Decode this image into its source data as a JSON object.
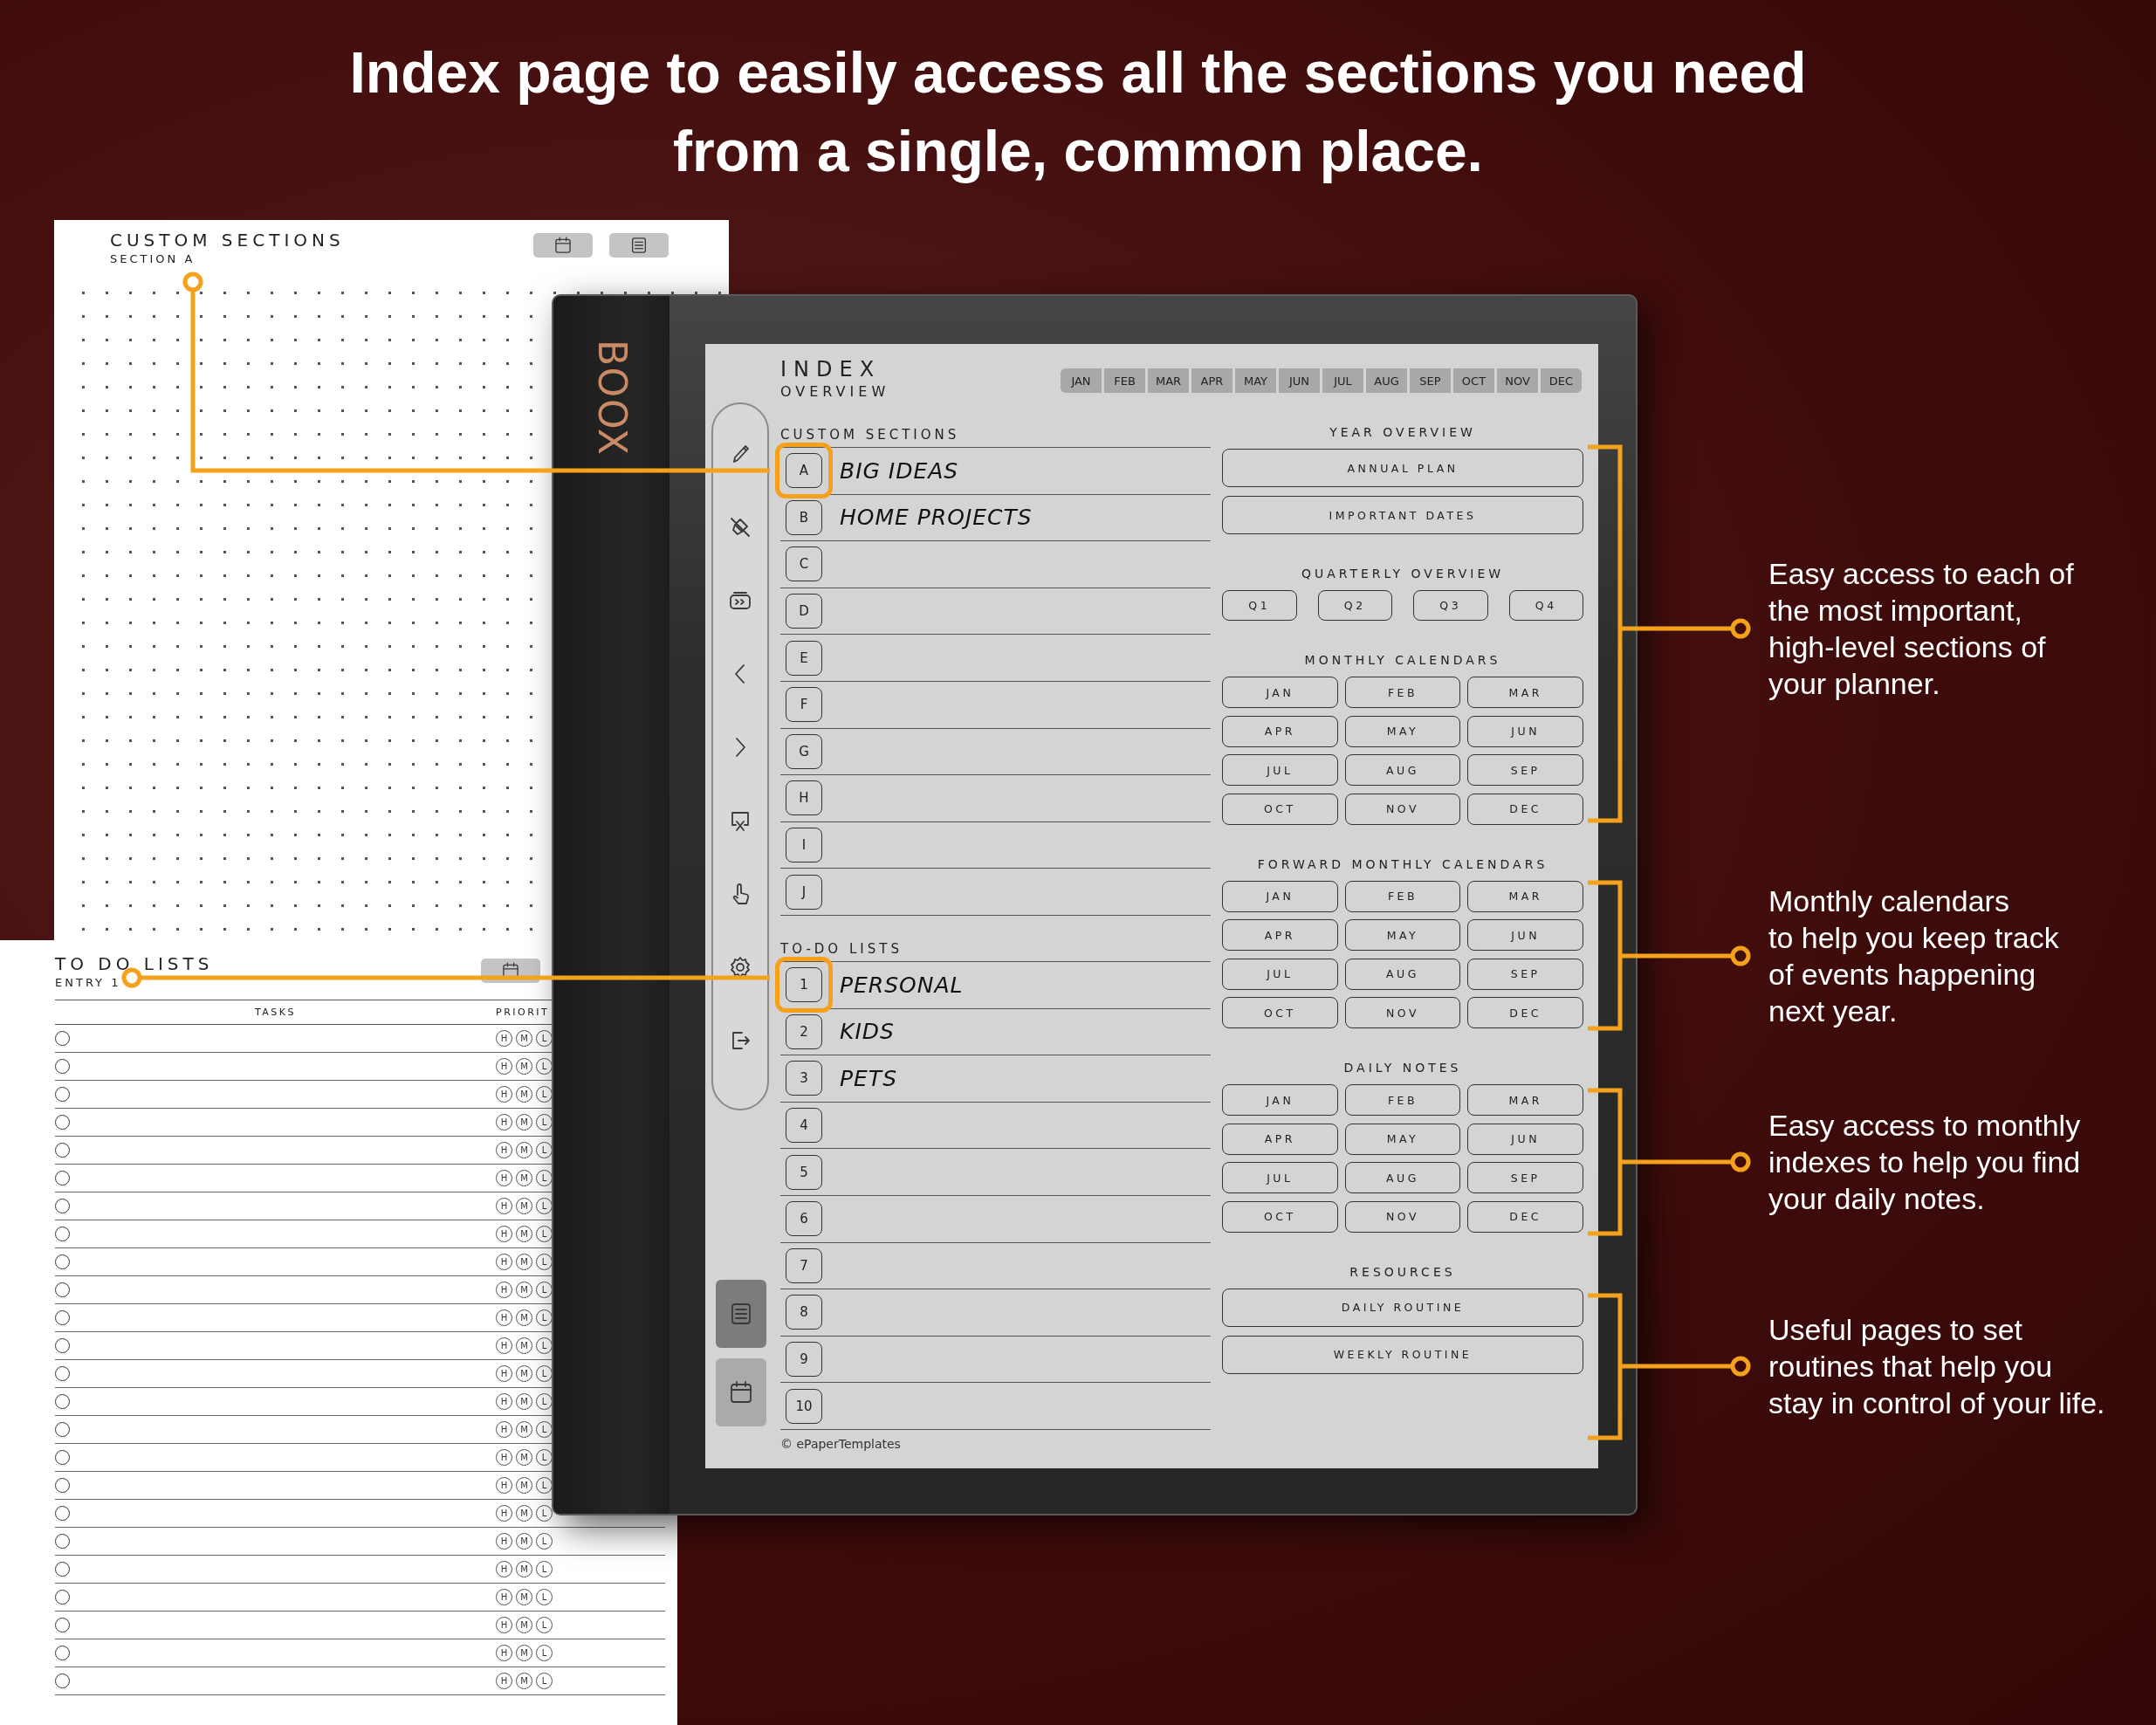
{
  "headline": {
    "lines": [
      "Index page to easily access all the sections you need",
      "from a single, common place."
    ]
  },
  "custom_sections_page": {
    "title": "CUSTOM SECTIONS",
    "subtitle": "SECTION A"
  },
  "todo_page": {
    "title": "TO DO LISTS",
    "subtitle": "ENTRY 1",
    "columns": [
      "TASKS",
      "PRIORIT"
    ],
    "rows": [
      {
        "checked": false,
        "priorities": [
          "H",
          "M",
          "L"
        ]
      },
      {
        "checked": false,
        "priorities": [
          "H",
          "M",
          "L"
        ]
      },
      {
        "checked": false,
        "priorities": [
          "H",
          "M",
          "L"
        ]
      },
      {
        "checked": false,
        "priorities": [
          "H",
          "M",
          "L"
        ]
      },
      {
        "checked": false,
        "priorities": [
          "H",
          "M",
          "L"
        ]
      },
      {
        "checked": false,
        "priorities": [
          "H",
          "M",
          "L"
        ]
      },
      {
        "checked": false,
        "priorities": [
          "H",
          "M",
          "L"
        ]
      },
      {
        "checked": false,
        "priorities": [
          "H",
          "M",
          "L"
        ]
      },
      {
        "checked": false,
        "priorities": [
          "H",
          "M",
          "L"
        ]
      },
      {
        "checked": false,
        "priorities": [
          "H",
          "M",
          "L"
        ]
      },
      {
        "checked": false,
        "priorities": [
          "H",
          "M",
          "L"
        ]
      },
      {
        "checked": false,
        "priorities": [
          "H",
          "M",
          "L"
        ]
      },
      {
        "checked": false,
        "priorities": [
          "H",
          "M",
          "L"
        ]
      },
      {
        "checked": false,
        "priorities": [
          "H",
          "M",
          "L"
        ]
      },
      {
        "checked": false,
        "priorities": [
          "H",
          "M",
          "L"
        ]
      },
      {
        "checked": false,
        "priorities": [
          "H",
          "M",
          "L"
        ]
      },
      {
        "checked": false,
        "priorities": [
          "H",
          "M",
          "L"
        ]
      },
      {
        "checked": false,
        "priorities": [
          "H",
          "M",
          "L"
        ]
      },
      {
        "checked": false,
        "priorities": [
          "H",
          "M",
          "L"
        ]
      },
      {
        "checked": false,
        "priorities": [
          "H",
          "M",
          "L"
        ]
      },
      {
        "checked": false,
        "priorities": [
          "H",
          "M",
          "L"
        ]
      },
      {
        "checked": false,
        "priorities": [
          "H",
          "M",
          "L"
        ]
      },
      {
        "checked": false,
        "priorities": [
          "H",
          "M",
          "L"
        ]
      },
      {
        "checked": false,
        "priorities": [
          "H",
          "M",
          "L"
        ]
      }
    ]
  },
  "device": {
    "brand": "BOOX"
  },
  "index_screen": {
    "title": "INDEX",
    "subtitle": "OVERVIEW",
    "month_tabs": [
      "JAN",
      "FEB",
      "MAR",
      "APR",
      "MAY",
      "JUN",
      "JUL",
      "AUG",
      "SEP",
      "OCT",
      "NOV",
      "DEC"
    ],
    "custom_sections": {
      "title": "CUSTOM SECTIONS",
      "rows": [
        {
          "key": "A",
          "entry": "BIG IDEAS",
          "highlighted": true
        },
        {
          "key": "B",
          "entry": "HOME PROJECTS",
          "highlighted": false
        },
        {
          "key": "C",
          "highlighted": false
        },
        {
          "key": "D",
          "highlighted": false
        },
        {
          "key": "E",
          "highlighted": false
        },
        {
          "key": "F",
          "highlighted": false
        },
        {
          "key": "G",
          "highlighted": false
        },
        {
          "key": "H",
          "highlighted": false
        },
        {
          "key": "I",
          "highlighted": false
        },
        {
          "key": "J",
          "highlighted": false
        }
      ]
    },
    "todo_lists": {
      "title": "TO-DO LISTS",
      "rows": [
        {
          "key": "1",
          "entry": "PERSONAL",
          "highlighted": true
        },
        {
          "key": "2",
          "entry": "KIDS",
          "highlighted": false
        },
        {
          "key": "3",
          "entry": "PETS",
          "highlighted": false
        },
        {
          "key": "4",
          "highlighted": false
        },
        {
          "key": "5",
          "highlighted": false
        },
        {
          "key": "6",
          "highlighted": false
        },
        {
          "key": "7",
          "highlighted": false
        },
        {
          "key": "8",
          "highlighted": false
        },
        {
          "key": "9",
          "highlighted": false
        },
        {
          "key": "10",
          "highlighted": false
        }
      ]
    },
    "copyright": "© ePaperTemplates",
    "sections": [
      {
        "kind": "wide",
        "title": "YEAR OVERVIEW",
        "buttons": [
          "ANNUAL PLAN",
          "IMPORTANT DATES"
        ]
      },
      {
        "kind": "quarters",
        "title": "QUARTERLY OVERVIEW",
        "buttons": [
          "Q1",
          "Q2",
          "Q3",
          "Q4"
        ]
      },
      {
        "kind": "months",
        "title": "MONTHLY CALENDARS",
        "buttons": [
          "JAN",
          "FEB",
          "MAR",
          "APR",
          "MAY",
          "JUN",
          "JUL",
          "AUG",
          "SEP",
          "OCT",
          "NOV",
          "DEC"
        ]
      },
      {
        "kind": "months",
        "title": "FORWARD MONTHLY CALENDARS",
        "buttons": [
          "JAN",
          "FEB",
          "MAR",
          "APR",
          "MAY",
          "JUN",
          "JUL",
          "AUG",
          "SEP",
          "OCT",
          "NOV",
          "DEC"
        ]
      },
      {
        "kind": "months",
        "title": "DAILY NOTES",
        "buttons": [
          "JAN",
          "FEB",
          "MAR",
          "APR",
          "MAY",
          "JUN",
          "JUL",
          "AUG",
          "SEP",
          "OCT",
          "NOV",
          "DEC"
        ]
      },
      {
        "kind": "wide",
        "title": "RESOURCES",
        "buttons": [
          "DAILY ROUTINE",
          "WEEKLY ROUTINE"
        ]
      }
    ]
  },
  "callouts": [
    {
      "lines": [
        "Easy access to each of",
        "the most important,",
        "high-level sections of",
        "your planner."
      ]
    },
    {
      "lines": [
        "Monthly calendars",
        "to help you keep track",
        "of events happening",
        "next year."
      ]
    },
    {
      "lines": [
        "Easy access to monthly",
        "indexes to help you find",
        "your daily notes."
      ]
    },
    {
      "lines": [
        "Useful pages to set",
        "routines that help you",
        "stay in control of your life."
      ]
    }
  ]
}
